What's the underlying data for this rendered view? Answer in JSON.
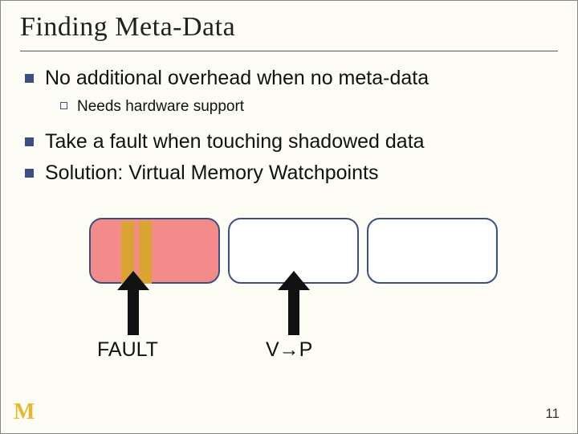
{
  "title": "Finding Meta-Data",
  "bullets": {
    "b1": "No additional overhead when no meta-data",
    "b1a": "Needs hardware support",
    "b2": "Take a fault when touching shadowed data",
    "b3": "Solution: Virtual Memory Watchpoints"
  },
  "labels": {
    "fault": "FAULT",
    "vp": "V→P"
  },
  "footer": {
    "logo": "M",
    "page": "11"
  }
}
